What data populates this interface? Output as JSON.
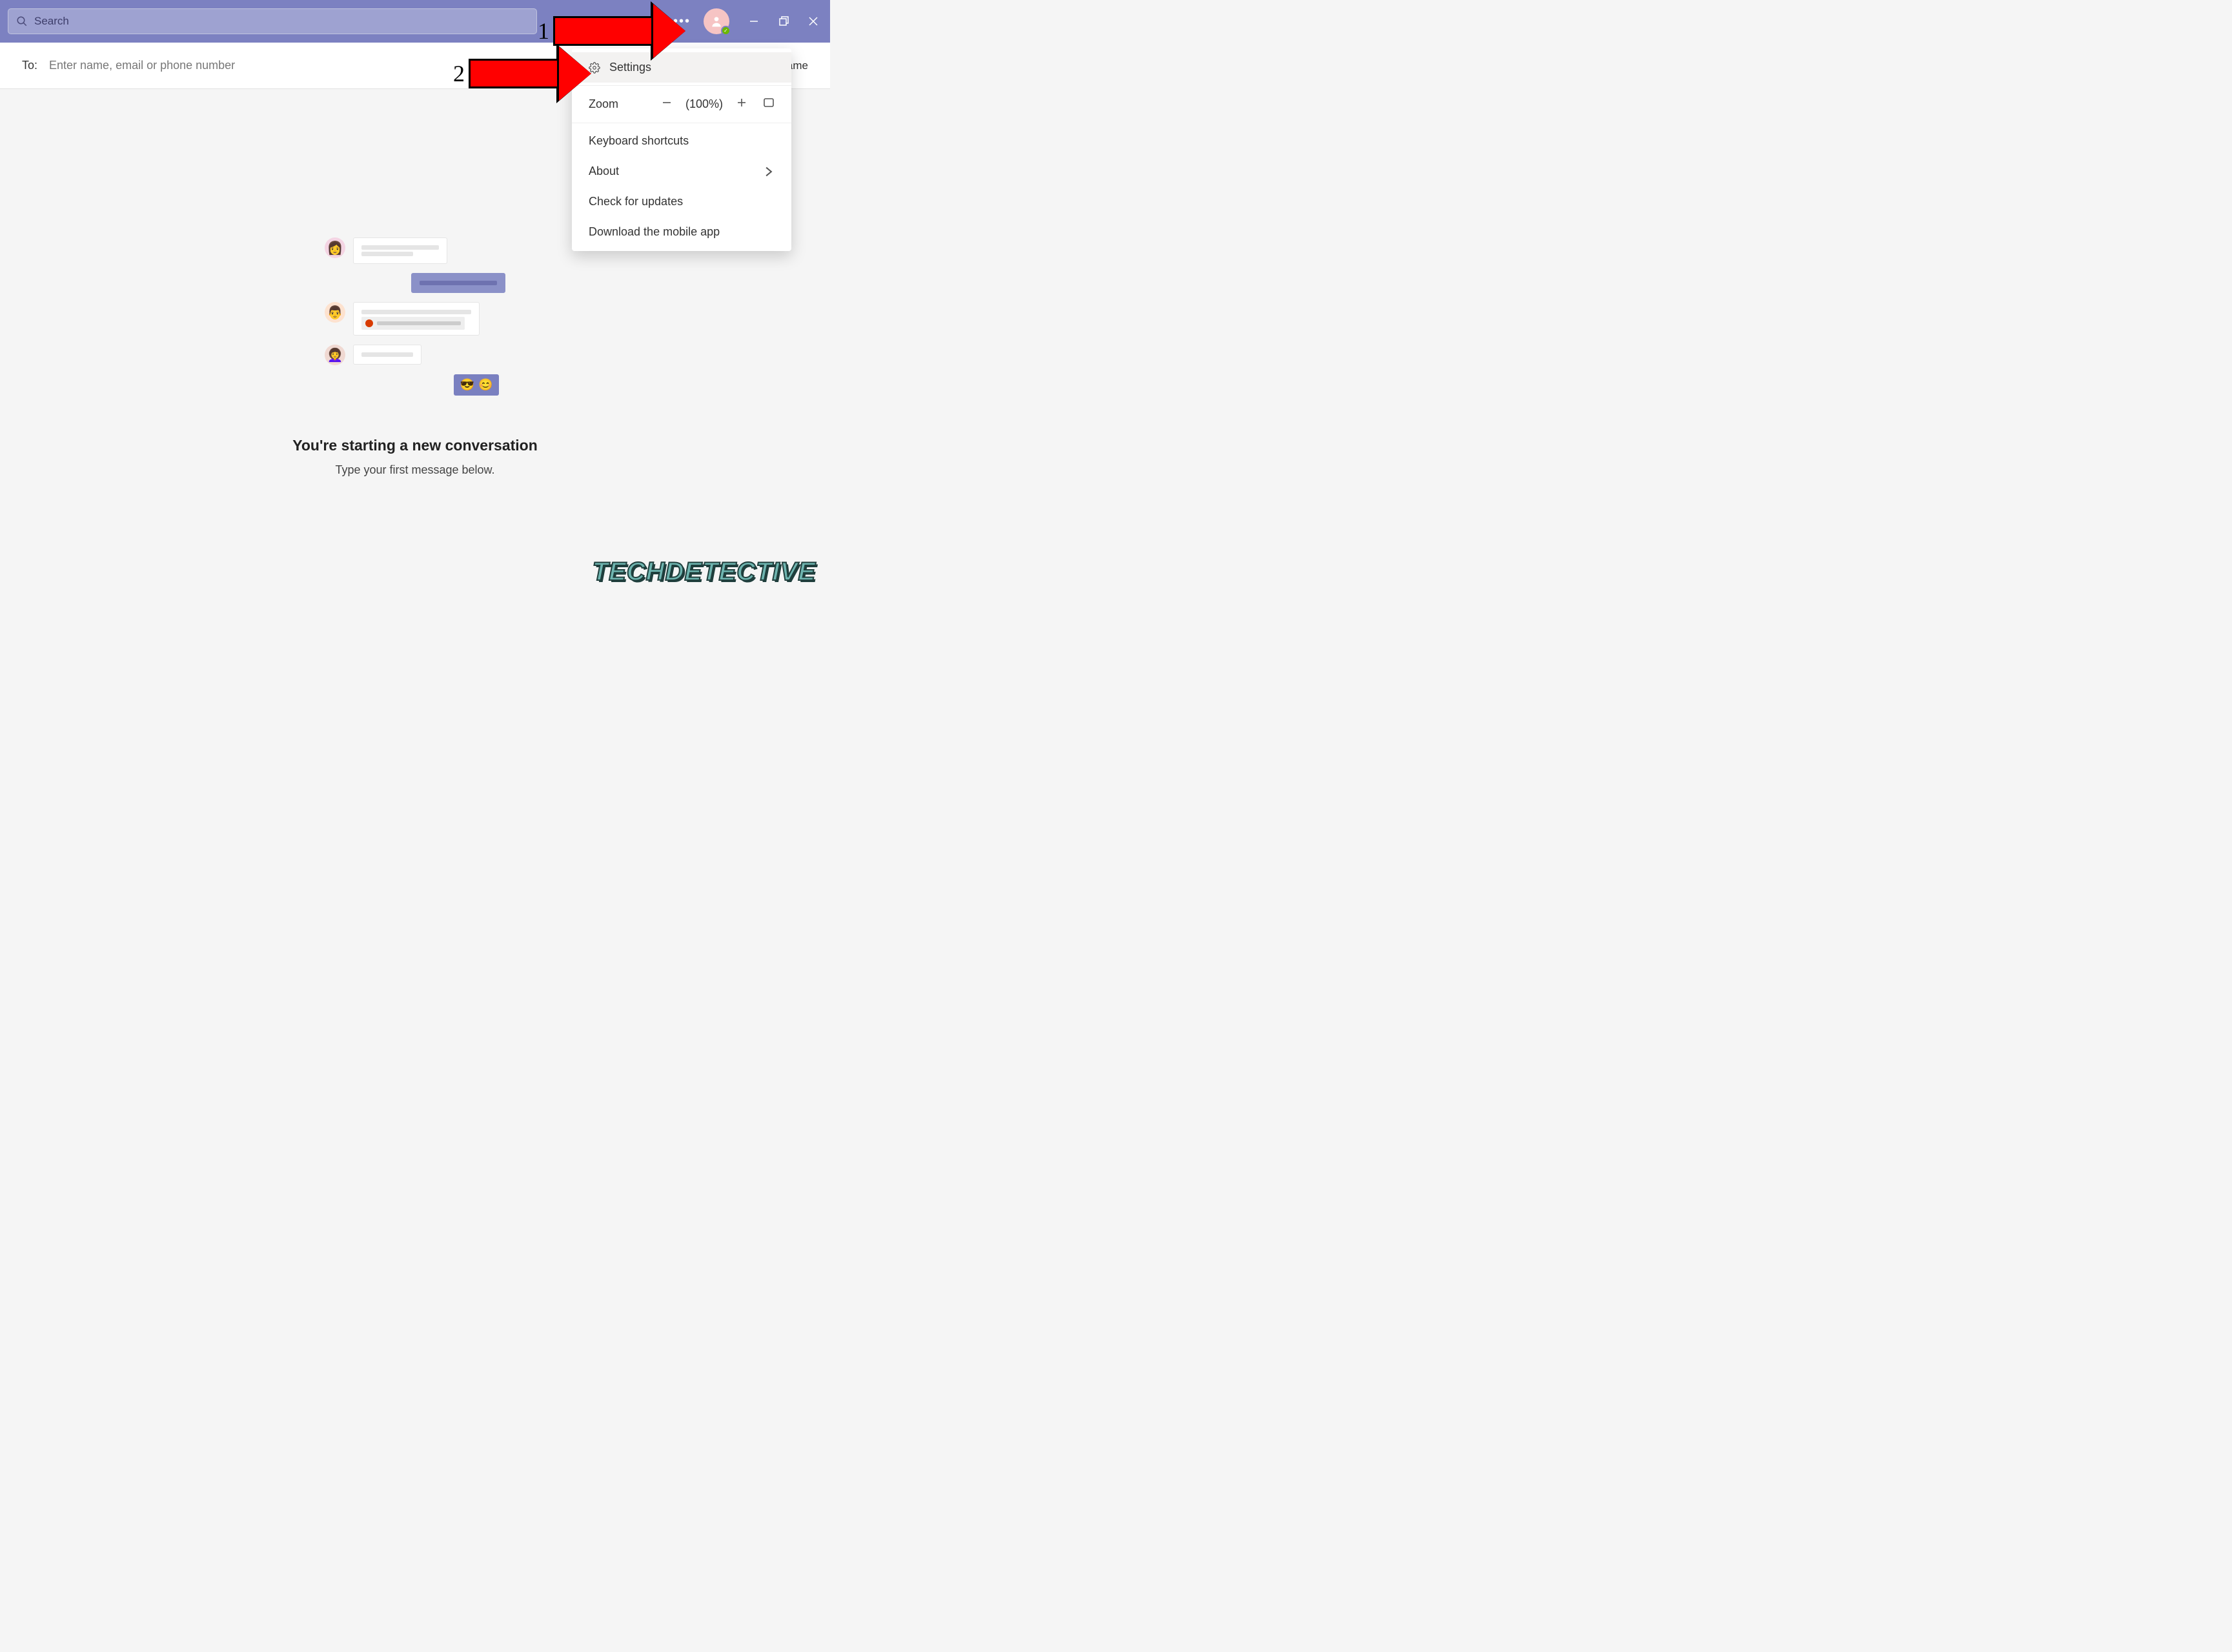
{
  "titlebar": {
    "search_placeholder": "Search"
  },
  "to_bar": {
    "label": "To:",
    "placeholder": "Enter name, email or phone number",
    "right_text": "p name"
  },
  "main": {
    "heading": "You're starting a new conversation",
    "subtext": "Type your first message below.",
    "reaction_emoji_1": "😎",
    "reaction_emoji_2": "😊"
  },
  "menu": {
    "settings": "Settings",
    "zoom_label": "Zoom",
    "zoom_value": "(100%)",
    "keyboard": "Keyboard shortcuts",
    "about": "About",
    "updates": "Check for updates",
    "mobile": "Download the mobile app"
  },
  "annotations": {
    "arrow1": "1",
    "arrow2": "2"
  },
  "watermark": "TECHDETECTIVE"
}
